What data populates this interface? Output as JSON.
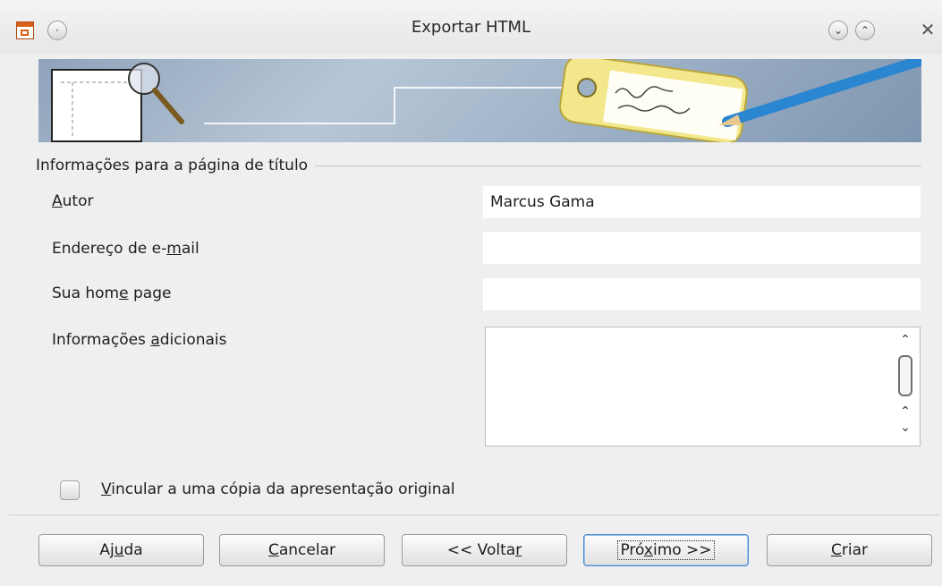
{
  "window": {
    "title": "Exportar HTML",
    "menu_icon": "circle-dot-icon",
    "minimize_icon": "chevron-down-icon",
    "maximize_icon": "chevron-up-icon",
    "close_icon": "close-icon"
  },
  "section": {
    "title": "Informações para a página de título"
  },
  "fields": {
    "author": {
      "label_pre": "",
      "label_mnemonic": "A",
      "label_post": "utor",
      "value": "Marcus Gama"
    },
    "email": {
      "label_pre": "Endereço de e-",
      "label_mnemonic": "m",
      "label_post": "ail",
      "value": ""
    },
    "homepage": {
      "label_pre": "Sua hom",
      "label_mnemonic": "e",
      "label_post": " page",
      "value": ""
    },
    "additional": {
      "label_pre": "Informações ",
      "label_mnemonic": "a",
      "label_post": "dicionais",
      "value": ""
    }
  },
  "checkbox": {
    "label_mnemonic": "V",
    "label_post": "incular a uma cópia da apresentação original",
    "checked": false
  },
  "buttons": {
    "help": {
      "pre": "Aj",
      "mn": "u",
      "post": "da"
    },
    "cancel": {
      "pre": "",
      "mn": "C",
      "post": "ancelar"
    },
    "back": {
      "pre": "<< Volta",
      "mn": "r",
      "post": ""
    },
    "next": {
      "pre": "Pró",
      "mn": "x",
      "post": "imo >>"
    },
    "create": {
      "pre": "",
      "mn": "C",
      "post": "riar"
    }
  },
  "colors": {
    "banner": "#9cb0c6",
    "default_button_border": "#4f8ad0"
  }
}
